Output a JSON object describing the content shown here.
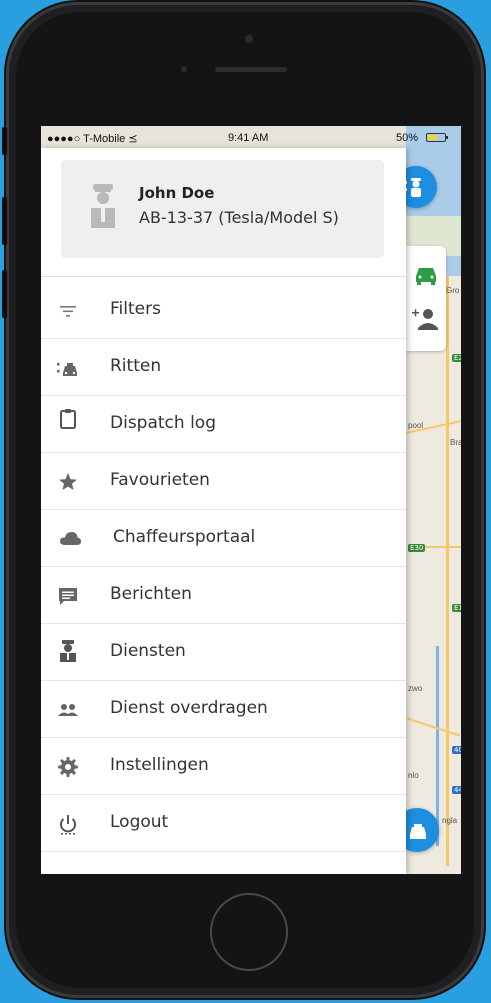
{
  "status_bar": {
    "carrier": "●●●●○ T-Mobile ⪯",
    "time": "9:41 AM",
    "battery": "50%"
  },
  "profile": {
    "name": "John Doe",
    "vehicle": "AB-13-37 (Tesla/Model S)",
    "avatar_icon": "chauffeur-icon"
  },
  "menu": {
    "items": [
      {
        "label": "Filters",
        "icon": "filter-icon"
      },
      {
        "label": "Ritten",
        "icon": "rides-icon"
      },
      {
        "label": "Dispatch log",
        "icon": "clipboard-icon"
      },
      {
        "label": "Favourieten",
        "icon": "star-icon"
      },
      {
        "label": "Chaffeursportaal",
        "icon": "cloud-icon"
      },
      {
        "label": "Berichten",
        "icon": "message-icon"
      },
      {
        "label": "Diensten",
        "icon": "chauffeur-icon"
      },
      {
        "label": "Dienst overdragen",
        "icon": "people-icon"
      },
      {
        "label": "Instellingen",
        "icon": "gear-icon"
      },
      {
        "label": "Logout",
        "icon": "power-icon"
      }
    ]
  },
  "map": {
    "labels": [
      "Gro",
      "pool",
      "Bra",
      "zwo",
      "nlo",
      "ngla"
    ],
    "shields": [
      "E2",
      "E30",
      "E1",
      "40",
      "44"
    ]
  },
  "colors": {
    "accent": "#1e8fe0",
    "background": "#2a9fe0",
    "icon": "#666666"
  }
}
